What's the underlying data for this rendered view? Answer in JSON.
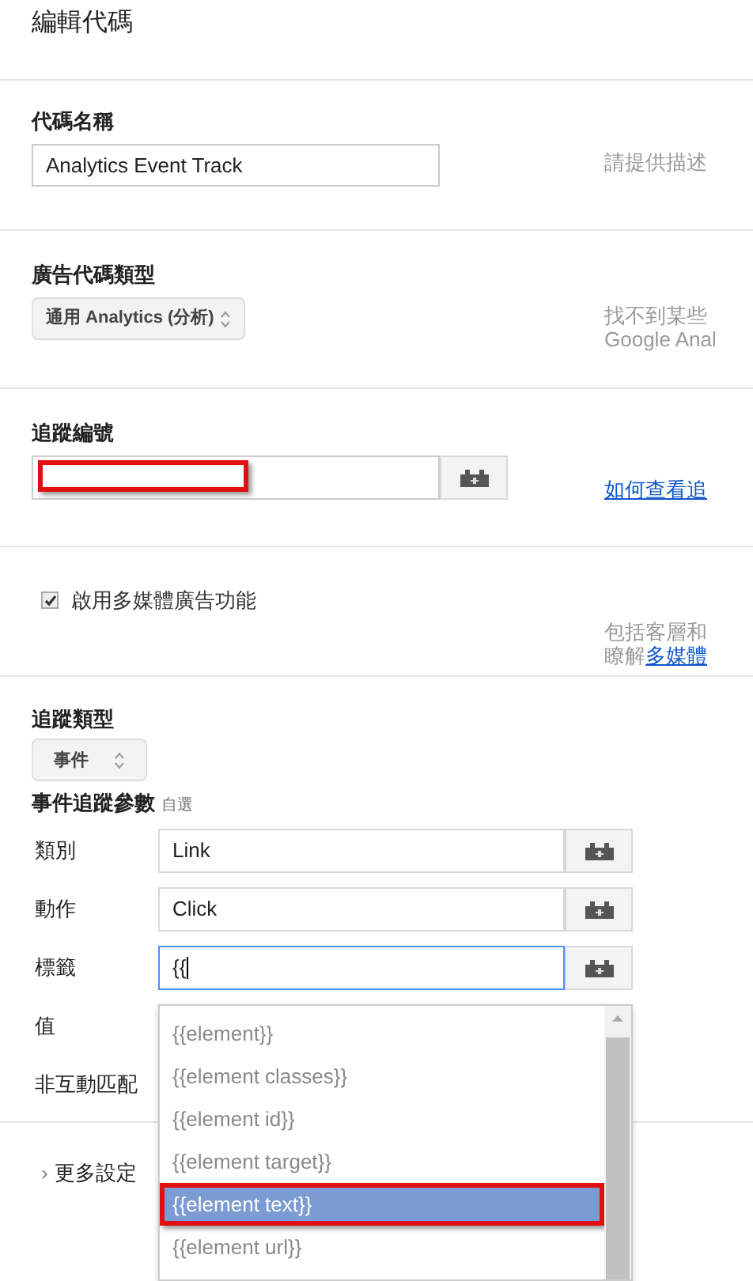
{
  "title": "編輯代碼",
  "sections": [
    {
      "kind": "text",
      "label": "代碼名稱",
      "value": "Analytics Event Track",
      "help": [
        "請提供描述"
      ]
    },
    {
      "kind": "select",
      "label": "廣告代碼類型",
      "value": "通用 Analytics (分析)",
      "help": [
        "找不到某些",
        "Google Anal"
      ]
    },
    {
      "kind": "tracking",
      "label": "追蹤編號",
      "highlighted": true,
      "link": "如何查看追"
    },
    {
      "kind": "checkbox",
      "label": "啟用多媒體廣告功能",
      "checked": true,
      "help": [
        "包括客層和"
      ],
      "help_prefix": "瞭解",
      "help_link": "多媒體"
    }
  ],
  "tracking_type": {
    "label": "追蹤類型",
    "value": "事件"
  },
  "params": {
    "label": "事件追蹤參數",
    "hint": "自選",
    "rows": [
      {
        "label": "類別",
        "value": "Link",
        "focused": false,
        "kind": "field"
      },
      {
        "label": "動作",
        "value": "Click",
        "focused": false,
        "kind": "field"
      },
      {
        "label": "標籤",
        "value": "{{",
        "focused": true,
        "kind": "field"
      },
      {
        "label": "值",
        "kind": "hidden"
      },
      {
        "label": "非互動匹配",
        "kind": "hidden"
      }
    ]
  },
  "dropdown": {
    "items": [
      {
        "label": "{{element}}",
        "selected": false,
        "highlighted": false
      },
      {
        "label": "{{element classes}}",
        "selected": false,
        "highlighted": false
      },
      {
        "label": "{{element id}}",
        "selected": false,
        "highlighted": false
      },
      {
        "label": "{{element target}}",
        "selected": false,
        "highlighted": false
      },
      {
        "label": "{{element text}}",
        "selected": true,
        "highlighted": true
      },
      {
        "label": "{{element url}}",
        "selected": false,
        "highlighted": false
      }
    ]
  },
  "more": {
    "arrow": "›",
    "label": "更多設定"
  }
}
